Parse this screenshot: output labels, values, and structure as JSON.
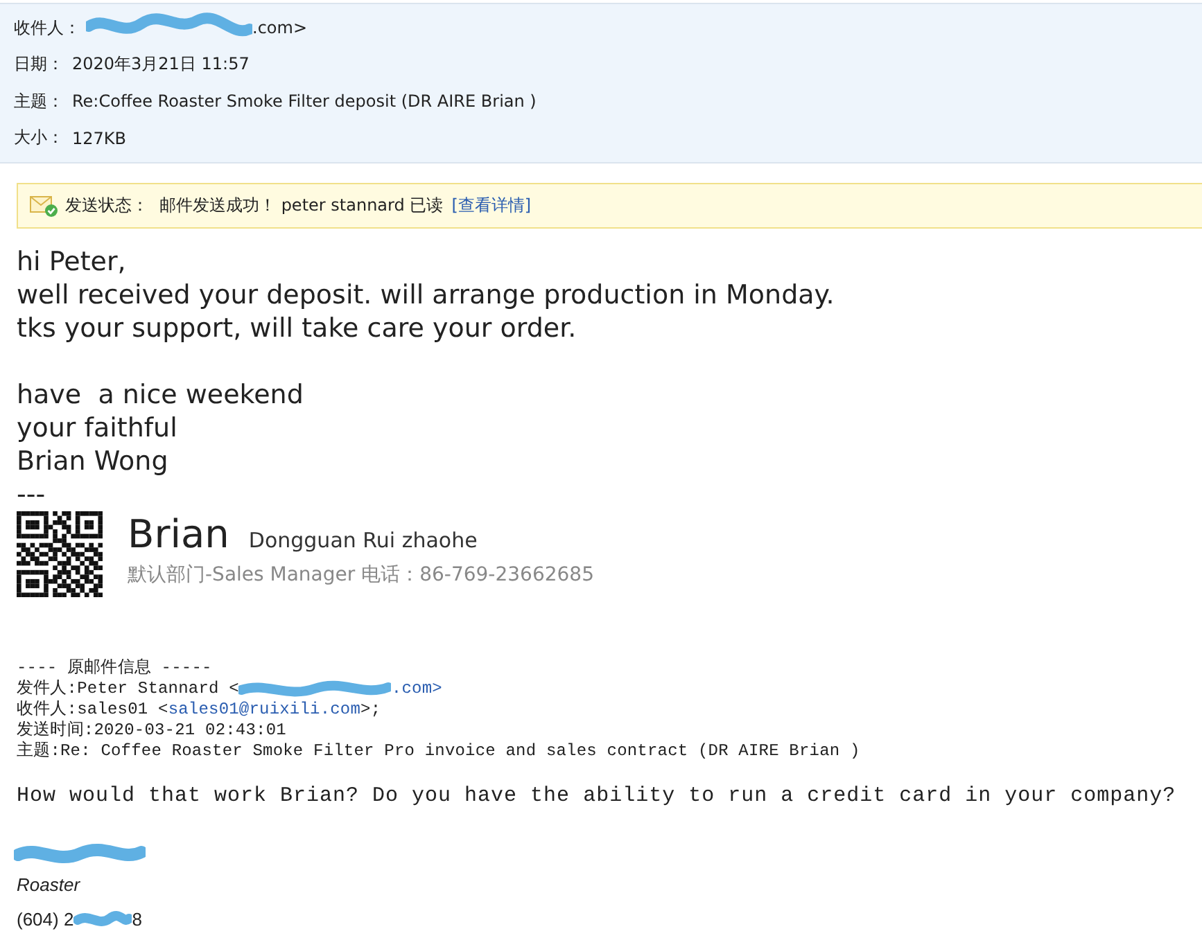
{
  "header": {
    "fields": [
      {
        "label": "收件人：",
        "value": ".com>",
        "redacted": true
      },
      {
        "label": "日期：",
        "value": "2020年3月21日 11:57",
        "redacted": false
      },
      {
        "label": "主题：",
        "value": "Re:Coffee Roaster Smoke Filter deposit (DR AIRE Brian )",
        "redacted": false
      },
      {
        "label": "大小：",
        "value": "127KB",
        "redacted": false
      }
    ]
  },
  "status": {
    "label": "发送状态：",
    "message": "邮件发送成功！ peter stannard 已读",
    "link": "[查看详情]"
  },
  "body": {
    "paragraphs": [
      [
        "hi Peter,",
        "well received your deposit. will arrange production in Monday.",
        "tks your support, will take care your order."
      ],
      [
        "have  a nice weekend",
        "your faithful",
        "Brian Wong",
        "---"
      ]
    ]
  },
  "signature": {
    "name": "Brian",
    "company": "Dongguan Rui zhaohe",
    "details": "默认部门-Sales Manager 电话：86-769-23662685"
  },
  "original": {
    "heading": "---- 原邮件信息 -----",
    "from": {
      "label": "发件人:Peter Stannard <",
      "value": ".com>",
      "redacted": true
    },
    "to": {
      "label": "收件人:sales01 <",
      "link": "sales01@ruixili.com",
      "suffix": ">;"
    },
    "sent": "发送时间:2020-03-21 02:43:01",
    "subject": "主题:Re: Coffee Roaster Smoke Filter Pro invoice and sales contract (DR AIRE Brian )",
    "message": "How would that work Brian? Do you have the ability to run a credit card in your company?",
    "sender_title": "Roaster",
    "phone_start": "(604) 2",
    "phone_end": "8"
  }
}
